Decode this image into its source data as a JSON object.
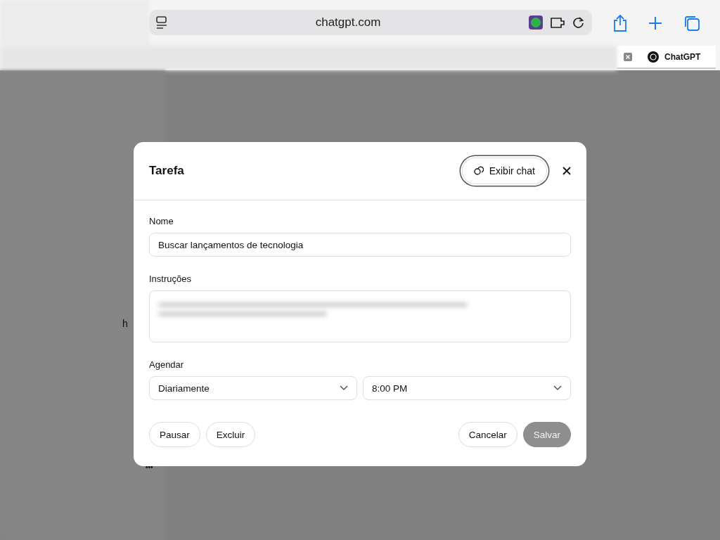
{
  "browser": {
    "address": "chatgpt.com",
    "tab": {
      "title": "ChatGPT"
    }
  },
  "background_texts": [
    {
      "text": "h"
    },
    {
      "text": "•••"
    }
  ],
  "dialog": {
    "title": "Tarefa",
    "view_chat_button": "Exibir chat",
    "name": {
      "label": "Nome",
      "value": "Buscar lançamentos de tecnologia"
    },
    "instructions": {
      "label": "Instruções"
    },
    "schedule": {
      "label": "Agendar",
      "frequency": "Diariamente",
      "time": "8:00 PM"
    },
    "left_buttons": [
      {
        "label": "Pausar",
        "disabled": false
      },
      {
        "label": "Excluir",
        "disabled": false
      }
    ],
    "right_buttons": [
      {
        "label": "Cancelar",
        "disabled": false
      },
      {
        "label": "Salvar",
        "disabled": true
      }
    ]
  }
}
